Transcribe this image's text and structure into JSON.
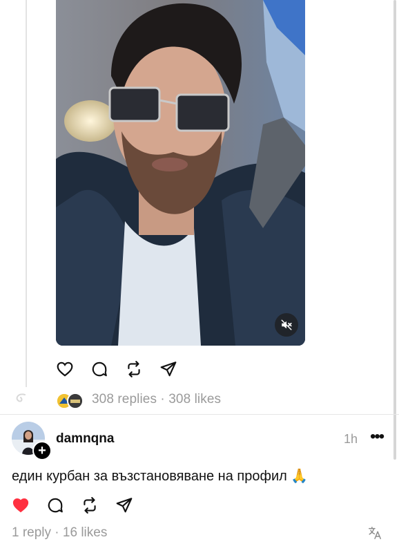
{
  "post": {
    "media_type": "video",
    "mute_icon": "speaker-muted-icon",
    "actions": [
      "heart-icon",
      "comment-icon",
      "repost-icon",
      "share-icon"
    ],
    "stats": "308 replies · 308 likes"
  },
  "reply": {
    "username": "damnqna",
    "time": "1h",
    "more": "•••",
    "follow_badge": "+",
    "text": "един курбан за възстановяване на профил",
    "emoji": "🙏",
    "liked": true,
    "like_color": "#ff3040",
    "stats": "1 reply · 16 likes",
    "translate_icon": "translate-icon"
  }
}
